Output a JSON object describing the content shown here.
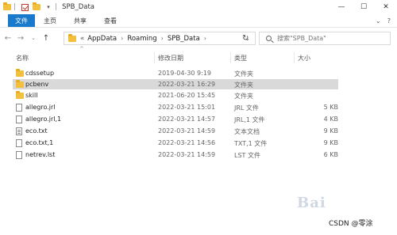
{
  "window": {
    "title": "SPB_Data",
    "controls": {
      "minimize": "—",
      "maximize": "☐",
      "close": "✕"
    }
  },
  "ribbon": {
    "tabs": [
      "文件",
      "主页",
      "共享",
      "查看"
    ]
  },
  "address": {
    "breadcrumbs": [
      "AppData",
      "Roaming",
      "SPB_Data"
    ],
    "prefix": "«",
    "search_placeholder": "搜索\"SPB_Data\""
  },
  "columns": {
    "name": "名称",
    "date": "修改日期",
    "type": "类型",
    "size": "大小"
  },
  "files": [
    {
      "name": "cdssetup",
      "date": "2019-04-30 9:19",
      "type": "文件夹",
      "size": "",
      "icon": "folder-icon",
      "selected": false
    },
    {
      "name": "pcbenv",
      "date": "2022-03-21 16:29",
      "type": "文件夹",
      "size": "",
      "icon": "folder-icon",
      "selected": true
    },
    {
      "name": "skill",
      "date": "2021-06-20 15:45",
      "type": "文件夹",
      "size": "",
      "icon": "folder-icon",
      "selected": false
    },
    {
      "name": "allegro.jrl",
      "date": "2022-03-21 15:01",
      "type": "JRL 文件",
      "size": "5 KB",
      "icon": "file-icon",
      "selected": false
    },
    {
      "name": "allegro.jrl,1",
      "date": "2022-03-21 14:57",
      "type": "JRL,1 文件",
      "size": "4 KB",
      "icon": "file-icon",
      "selected": false
    },
    {
      "name": "eco.txt",
      "date": "2022-03-21 14:59",
      "type": "文本文档",
      "size": "9 KB",
      "icon": "text-file-icon",
      "selected": false
    },
    {
      "name": "eco.txt,1",
      "date": "2022-03-21 14:56",
      "type": "TXT,1 文件",
      "size": "9 KB",
      "icon": "file-icon",
      "selected": false
    },
    {
      "name": "netrev.lst",
      "date": "2022-03-21 14:59",
      "type": "LST 文件",
      "size": "6 KB",
      "icon": "file-icon",
      "selected": false
    }
  ],
  "watermark": {
    "logo": "Bai",
    "credit": "CSDN @零涂"
  }
}
